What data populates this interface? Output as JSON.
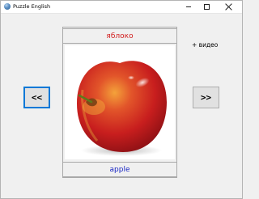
{
  "window": {
    "title": "Puzzle English",
    "app_icon": "app-globe-icon"
  },
  "card": {
    "word_native": "яблоко",
    "word_native_color": "#d21f1f",
    "word_english": "apple",
    "word_english_color": "#1b28c4",
    "image": "red-apple-photo"
  },
  "nav": {
    "prev_label": "<<",
    "next_label": ">>"
  },
  "extra": {
    "video_label": "+ видео"
  },
  "accent_color": "#0078d7"
}
